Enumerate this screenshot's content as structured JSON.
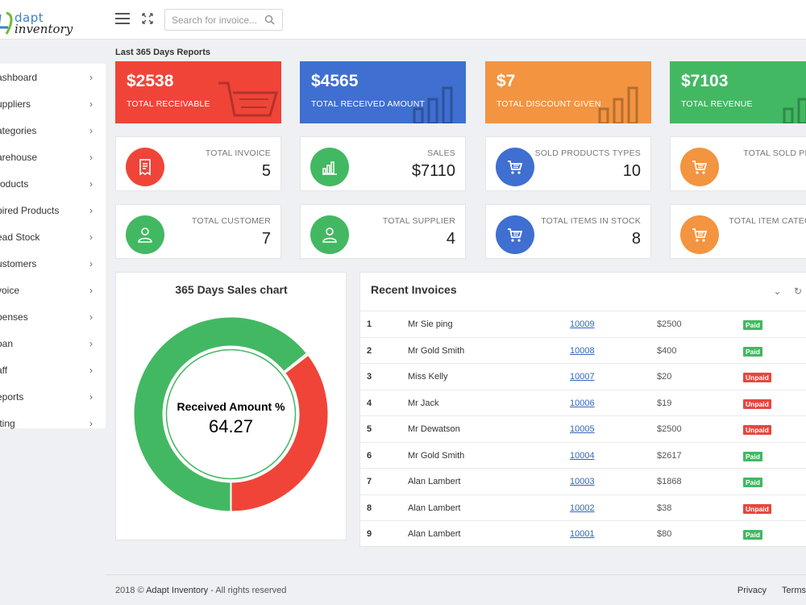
{
  "header": {
    "logo_top": "dapt",
    "logo_bottom": "inventory",
    "search_placeholder": "Search for invoice..."
  },
  "sidebar": {
    "items": [
      {
        "label": "ashboard"
      },
      {
        "label": "uppliers"
      },
      {
        "label": "ategories"
      },
      {
        "label": "arehouse"
      },
      {
        "label": "roducts"
      },
      {
        "label": "pired Products"
      },
      {
        "label": "ead Stock"
      },
      {
        "label": "ustomers"
      },
      {
        "label": "voice"
      },
      {
        "label": "penses"
      },
      {
        "label": "oan"
      },
      {
        "label": "aff"
      },
      {
        "label": "eports"
      },
      {
        "label": "tting"
      }
    ]
  },
  "section_title": "Last 365 Days Reports",
  "stats": [
    {
      "value": "$2538",
      "caption": "TOTAL RECEIVABLE",
      "color": "#f04438",
      "icon": "cart-icon"
    },
    {
      "value": "$4565",
      "caption": "TOTAL RECEIVED AMOUNT",
      "color": "#3f6fd0",
      "icon": "bar-chart-icon"
    },
    {
      "value": "$7",
      "caption": "TOTAL DISCOUNT GIVEN",
      "color": "#f39440",
      "icon": "bar-chart-icon"
    },
    {
      "value": "$7103",
      "caption": "TOTAL REVENUE",
      "color": "#43b862",
      "icon": "bar-chart-icon"
    }
  ],
  "cards": [
    {
      "caption": "TOTAL INVOICE",
      "value": "5",
      "color": "#f04438",
      "icon": "receipt-icon"
    },
    {
      "caption": "SALES",
      "value": "$7110",
      "color": "#43b862",
      "icon": "bar-chart-icon"
    },
    {
      "caption": "SOLD PRODUCTS TYPES",
      "value": "10",
      "color": "#3f6fd0",
      "icon": "cart-icon"
    },
    {
      "caption": "TOTAL SOLD PRO...",
      "value": "",
      "color": "#f39440",
      "icon": "cart-icon"
    },
    {
      "caption": "TOTAL CUSTOMER",
      "value": "7",
      "color": "#43b862",
      "icon": "user-icon"
    },
    {
      "caption": "TOTAL SUPPLIER",
      "value": "4",
      "color": "#43b862",
      "icon": "user-icon"
    },
    {
      "caption": "TOTAL ITEMS IN STOCK",
      "value": "8",
      "color": "#3f6fd0",
      "icon": "cart-icon"
    },
    {
      "caption": "TOTAL ITEM CATEGO...",
      "value": "",
      "color": "#f39440",
      "icon": "cart-icon"
    }
  ],
  "donut": {
    "title": "365 Days Sales chart",
    "label": "Received Amount %",
    "value": "64.27",
    "percent": 64.27,
    "received_color": "#43b862",
    "remaining_color": "#f04438",
    "discount_color": "#f39440"
  },
  "invoices": {
    "title": "Recent Invoices",
    "rows": [
      {
        "num": "1",
        "name": "Mr Sie ping",
        "id": "10009",
        "amount": "$2500",
        "status": "Paid"
      },
      {
        "num": "2",
        "name": "Mr Gold Smith",
        "id": "10008",
        "amount": "$400",
        "status": "Paid"
      },
      {
        "num": "3",
        "name": "Miss Kelly",
        "id": "10007",
        "amount": "$20",
        "status": "Unpaid"
      },
      {
        "num": "4",
        "name": "Mr Jack",
        "id": "10006",
        "amount": "$19",
        "status": "Unpaid"
      },
      {
        "num": "5",
        "name": "Mr Dewatson",
        "id": "10005",
        "amount": "$2500",
        "status": "Unpaid"
      },
      {
        "num": "6",
        "name": "Mr Gold Smith",
        "id": "10004",
        "amount": "$2617",
        "status": "Paid"
      },
      {
        "num": "7",
        "name": "Alan Lambert",
        "id": "10003",
        "amount": "$1868",
        "status": "Paid"
      },
      {
        "num": "8",
        "name": "Alan Lambert",
        "id": "10002",
        "amount": "$38",
        "status": "Unpaid"
      },
      {
        "num": "9",
        "name": "Alan Lambert",
        "id": "10001",
        "amount": "$80",
        "status": "Paid"
      }
    ]
  },
  "footer": {
    "year": "2018 ©",
    "brand": "Adapt Inventory",
    "rights": "- All rights reserved",
    "privacy": "Privacy",
    "terms": "Terms"
  }
}
